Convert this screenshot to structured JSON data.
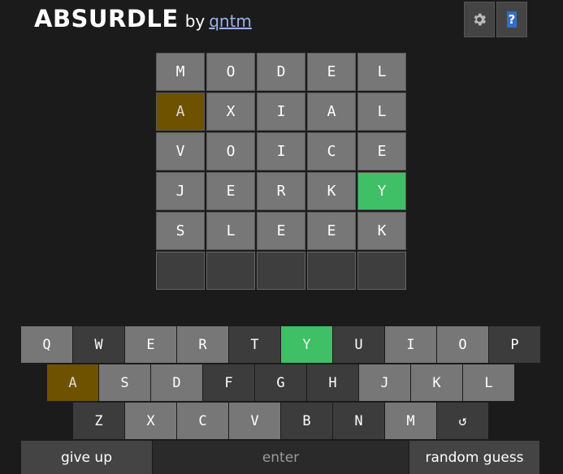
{
  "header": {
    "title": "ABSURDLE",
    "by": "by",
    "author": "qntm",
    "help_label": "?"
  },
  "board": {
    "rows": [
      [
        {
          "l": "M",
          "s": "absent"
        },
        {
          "l": "O",
          "s": "absent"
        },
        {
          "l": "D",
          "s": "absent"
        },
        {
          "l": "E",
          "s": "absent"
        },
        {
          "l": "L",
          "s": "absent"
        }
      ],
      [
        {
          "l": "A",
          "s": "present"
        },
        {
          "l": "X",
          "s": "absent"
        },
        {
          "l": "I",
          "s": "absent"
        },
        {
          "l": "A",
          "s": "absent"
        },
        {
          "l": "L",
          "s": "absent"
        }
      ],
      [
        {
          "l": "V",
          "s": "absent"
        },
        {
          "l": "O",
          "s": "absent"
        },
        {
          "l": "I",
          "s": "absent"
        },
        {
          "l": "C",
          "s": "absent"
        },
        {
          "l": "E",
          "s": "absent"
        }
      ],
      [
        {
          "l": "J",
          "s": "absent"
        },
        {
          "l": "E",
          "s": "absent"
        },
        {
          "l": "R",
          "s": "absent"
        },
        {
          "l": "K",
          "s": "absent"
        },
        {
          "l": "Y",
          "s": "correct"
        }
      ],
      [
        {
          "l": "S",
          "s": "absent"
        },
        {
          "l": "L",
          "s": "absent"
        },
        {
          "l": "E",
          "s": "absent"
        },
        {
          "l": "E",
          "s": "absent"
        },
        {
          "l": "K",
          "s": "absent"
        }
      ],
      [
        {
          "l": "",
          "s": "empty"
        },
        {
          "l": "",
          "s": "empty"
        },
        {
          "l": "",
          "s": "empty"
        },
        {
          "l": "",
          "s": "empty"
        },
        {
          "l": "",
          "s": "empty"
        }
      ]
    ]
  },
  "keyboard": {
    "row1": [
      {
        "k": "Q",
        "s": "unknown"
      },
      {
        "k": "W",
        "s": "absent"
      },
      {
        "k": "E",
        "s": "unknown"
      },
      {
        "k": "R",
        "s": "unknown"
      },
      {
        "k": "T",
        "s": "absent"
      },
      {
        "k": "Y",
        "s": "correct"
      },
      {
        "k": "U",
        "s": "absent"
      },
      {
        "k": "I",
        "s": "unknown"
      },
      {
        "k": "O",
        "s": "unknown"
      },
      {
        "k": "P",
        "s": "absent"
      }
    ],
    "row2": [
      {
        "k": "A",
        "s": "present"
      },
      {
        "k": "S",
        "s": "unknown"
      },
      {
        "k": "D",
        "s": "unknown"
      },
      {
        "k": "F",
        "s": "absent"
      },
      {
        "k": "G",
        "s": "absent"
      },
      {
        "k": "H",
        "s": "absent"
      },
      {
        "k": "J",
        "s": "unknown"
      },
      {
        "k": "K",
        "s": "unknown"
      },
      {
        "k": "L",
        "s": "unknown"
      }
    ],
    "row3": [
      {
        "k": "Z",
        "s": "absent"
      },
      {
        "k": "X",
        "s": "unknown"
      },
      {
        "k": "C",
        "s": "unknown"
      },
      {
        "k": "V",
        "s": "unknown"
      },
      {
        "k": "B",
        "s": "absent"
      },
      {
        "k": "N",
        "s": "absent"
      },
      {
        "k": "M",
        "s": "unknown"
      },
      {
        "k": "↺",
        "s": "absent",
        "name": "undo-icon"
      }
    ],
    "give_up": "give up",
    "enter": "enter",
    "random_guess": "random guess"
  },
  "colors": {
    "background": "#1b1b1b",
    "absent_tile": "#777777",
    "present": "#6e5200",
    "correct": "#3fc066",
    "key_absent": "#3c3c3c"
  }
}
